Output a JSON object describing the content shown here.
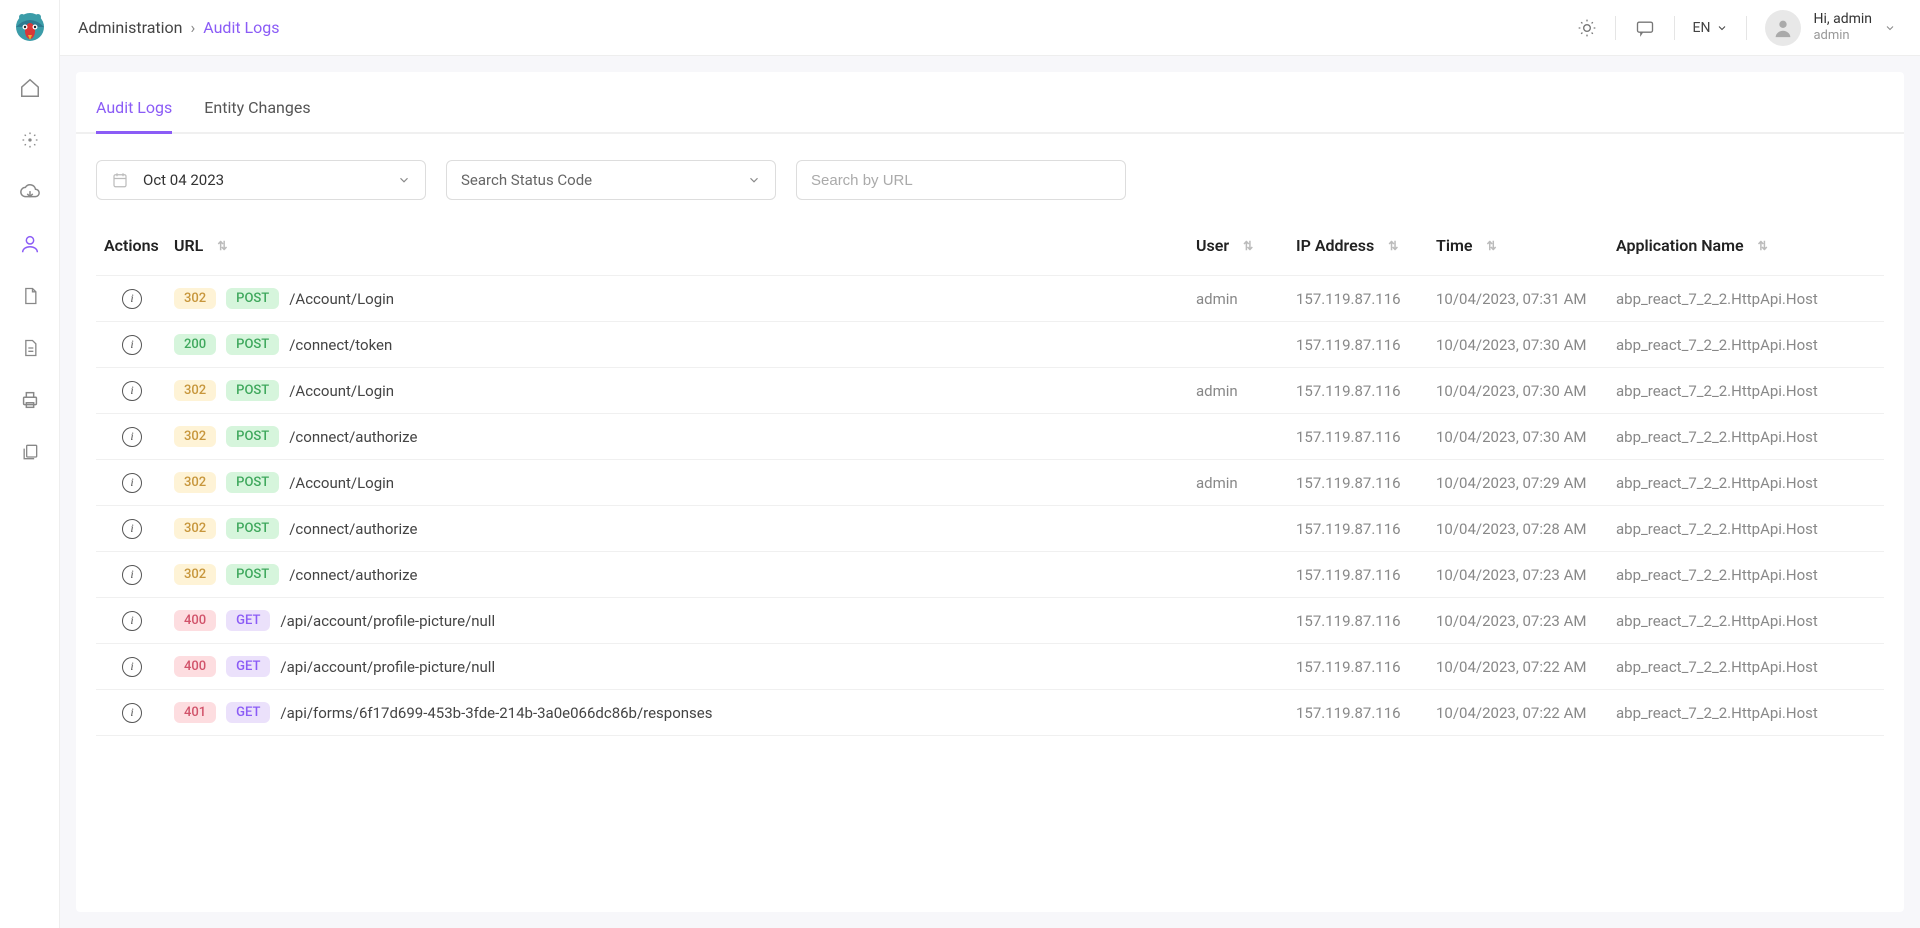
{
  "breadcrumb": {
    "root": "Administration",
    "current": "Audit Logs"
  },
  "topbar": {
    "language": "EN",
    "greeting": "Hi, admin",
    "role": "admin"
  },
  "tabs": {
    "audit_logs": "Audit Logs",
    "entity_changes": "Entity Changes"
  },
  "filters": {
    "date_value": "Oct 04 2023",
    "status_placeholder": "Search Status Code",
    "url_placeholder": "Search by URL"
  },
  "columns": {
    "actions": "Actions",
    "url": "URL",
    "user": "User",
    "ip": "IP Address",
    "time": "Time",
    "app": "Application Name"
  },
  "rows": [
    {
      "status": "302",
      "method": "POST",
      "url": "/Account/Login",
      "user": "admin",
      "ip": "157.119.87.116",
      "time": "10/04/2023, 07:31 AM",
      "app": "abp_react_7_2_2.HttpApi.Host"
    },
    {
      "status": "200",
      "method": "POST",
      "url": "/connect/token",
      "user": "",
      "ip": "157.119.87.116",
      "time": "10/04/2023, 07:30 AM",
      "app": "abp_react_7_2_2.HttpApi.Host"
    },
    {
      "status": "302",
      "method": "POST",
      "url": "/Account/Login",
      "user": "admin",
      "ip": "157.119.87.116",
      "time": "10/04/2023, 07:30 AM",
      "app": "abp_react_7_2_2.HttpApi.Host"
    },
    {
      "status": "302",
      "method": "POST",
      "url": "/connect/authorize",
      "user": "",
      "ip": "157.119.87.116",
      "time": "10/04/2023, 07:30 AM",
      "app": "abp_react_7_2_2.HttpApi.Host"
    },
    {
      "status": "302",
      "method": "POST",
      "url": "/Account/Login",
      "user": "admin",
      "ip": "157.119.87.116",
      "time": "10/04/2023, 07:29 AM",
      "app": "abp_react_7_2_2.HttpApi.Host"
    },
    {
      "status": "302",
      "method": "POST",
      "url": "/connect/authorize",
      "user": "",
      "ip": "157.119.87.116",
      "time": "10/04/2023, 07:28 AM",
      "app": "abp_react_7_2_2.HttpApi.Host"
    },
    {
      "status": "302",
      "method": "POST",
      "url": "/connect/authorize",
      "user": "",
      "ip": "157.119.87.116",
      "time": "10/04/2023, 07:23 AM",
      "app": "abp_react_7_2_2.HttpApi.Host"
    },
    {
      "status": "400",
      "method": "GET",
      "url": "/api/account/profile-picture/null",
      "user": "",
      "ip": "157.119.87.116",
      "time": "10/04/2023, 07:23 AM",
      "app": "abp_react_7_2_2.HttpApi.Host"
    },
    {
      "status": "400",
      "method": "GET",
      "url": "/api/account/profile-picture/null",
      "user": "",
      "ip": "157.119.87.116",
      "time": "10/04/2023, 07:22 AM",
      "app": "abp_react_7_2_2.HttpApi.Host"
    },
    {
      "status": "401",
      "method": "GET",
      "url": "/api/forms/6f17d699-453b-3fde-214b-3a0e066dc86b/responses",
      "user": "",
      "ip": "157.119.87.116",
      "time": "10/04/2023, 07:22 AM",
      "app": "abp_react_7_2_2.HttpApi.Host"
    }
  ]
}
